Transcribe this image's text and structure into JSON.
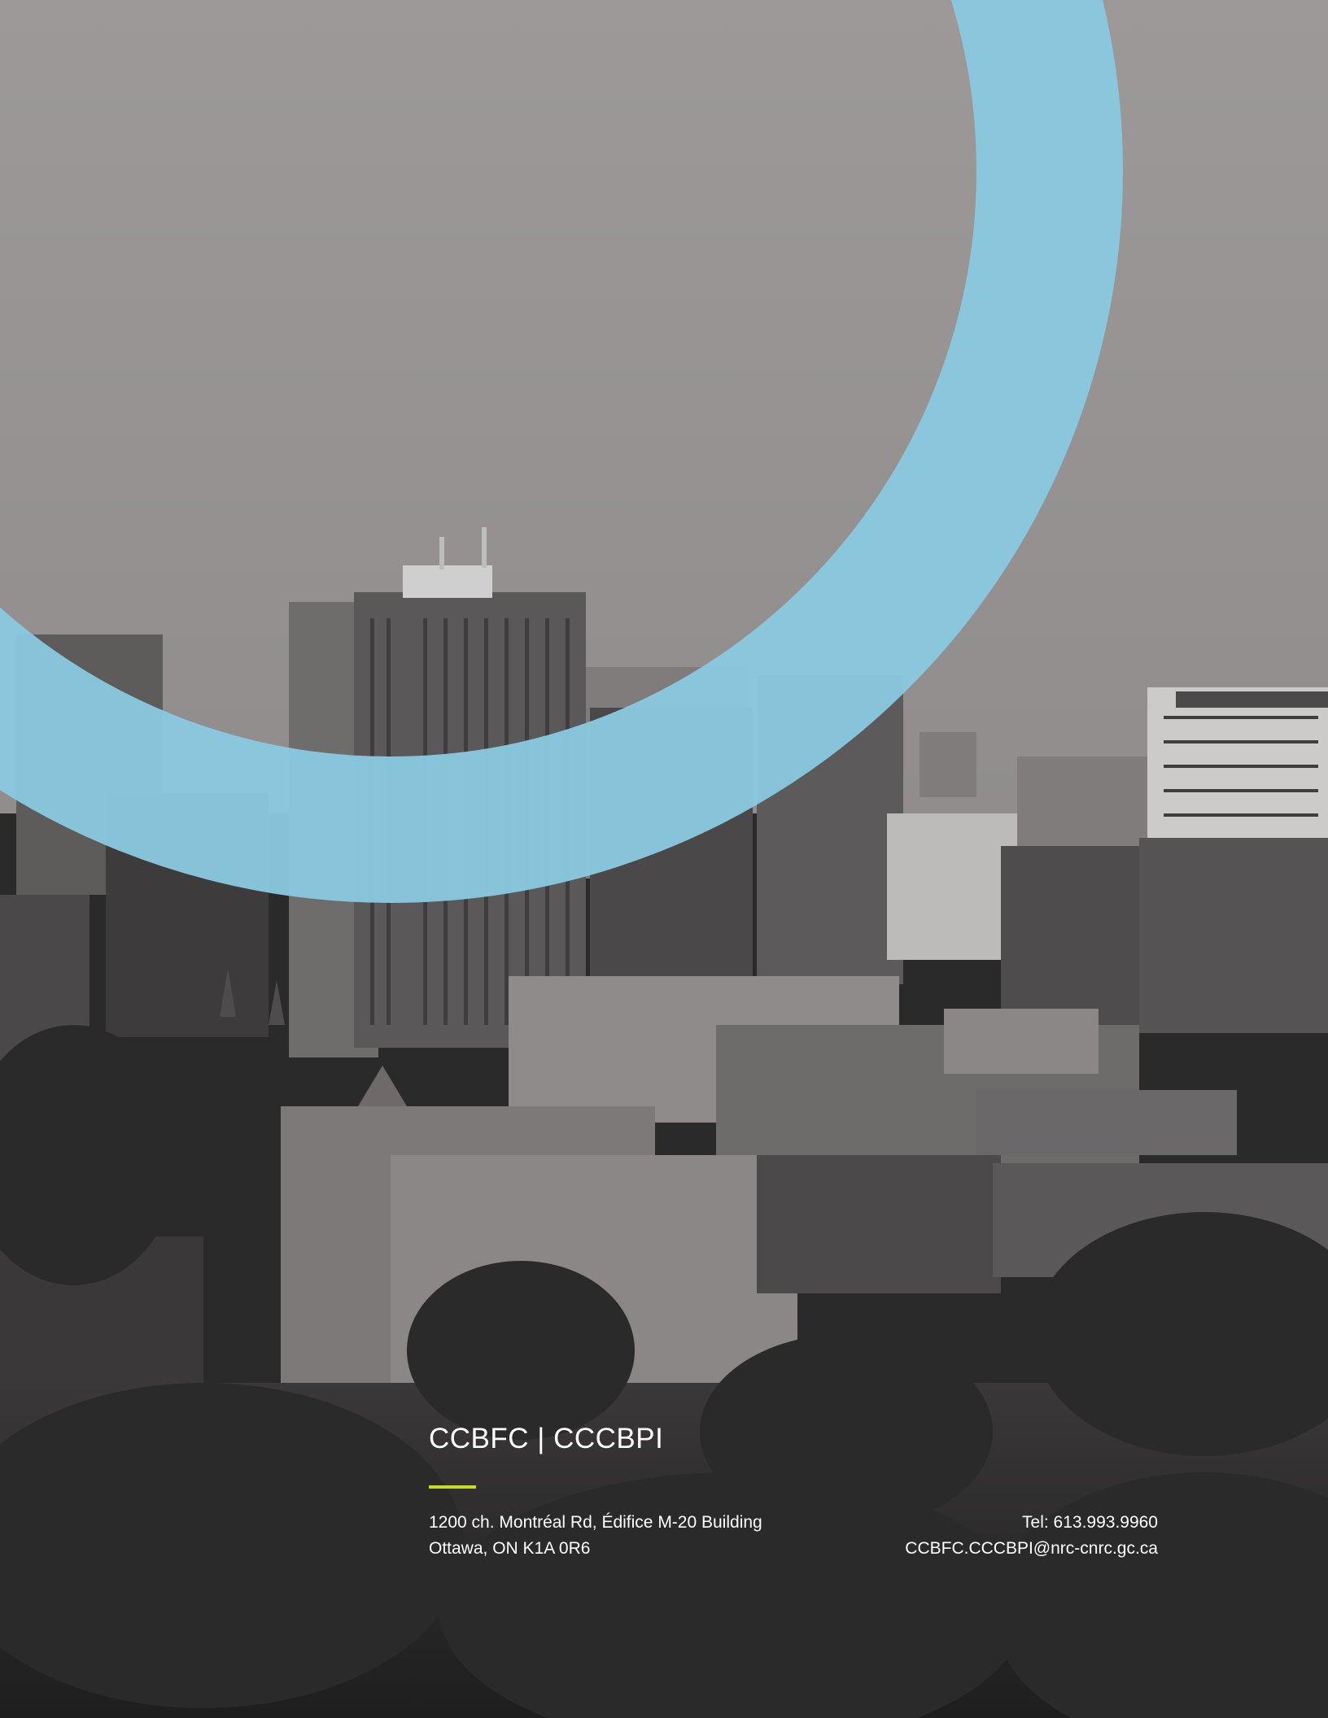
{
  "organization": {
    "title": "CCBFC | CCCBPI"
  },
  "address": {
    "line1": "1200 ch. Montréal Rd, Édifice M-20 Building",
    "line2": "Ottawa, ON  K1A 0R6"
  },
  "contact": {
    "telephone": "Tel: 613.993.9960",
    "email": "CCBFC.CCCBPI@nrc-cnrc.gc.ca"
  },
  "colors": {
    "ring": "#89c9df",
    "accent_rule": "#c8dc1e",
    "sky": "#9a9796",
    "text": "#ffffff"
  }
}
